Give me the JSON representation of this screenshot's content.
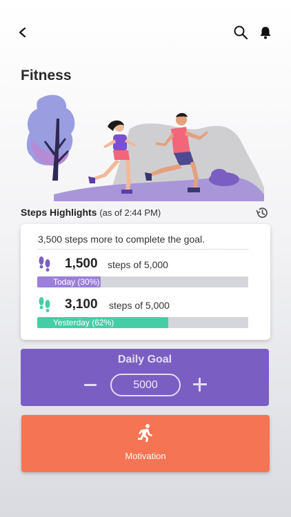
{
  "header": {
    "back_icon": "chevron-left-icon",
    "search_icon": "search-icon",
    "notification_icon": "bell-icon"
  },
  "page": {
    "title": "Fitness"
  },
  "highlights": {
    "title": "Steps Highlights",
    "as_of": "(as of 2:44 PM)",
    "history_icon": "history-icon"
  },
  "steps_card": {
    "remaining_text": "3,500 steps more to complete the goal.",
    "today": {
      "steps": "1,500",
      "of_text": "steps of 5,000",
      "bar_label": "Today (30%)",
      "progress": 0.3,
      "color": "#9b7fd8",
      "icon": "footprints-icon"
    },
    "yesterday": {
      "steps": "3,100",
      "of_text": "steps of 5,000",
      "bar_label": "Yesterday (62%)",
      "progress": 0.62,
      "color": "#45cda6",
      "icon": "footprints-icon"
    }
  },
  "daily_goal": {
    "title": "Daily Goal",
    "value": "5000",
    "color": "#7b5ec2"
  },
  "motivation": {
    "label": "Motivation",
    "icon": "running-person-icon",
    "color": "#f47454"
  }
}
